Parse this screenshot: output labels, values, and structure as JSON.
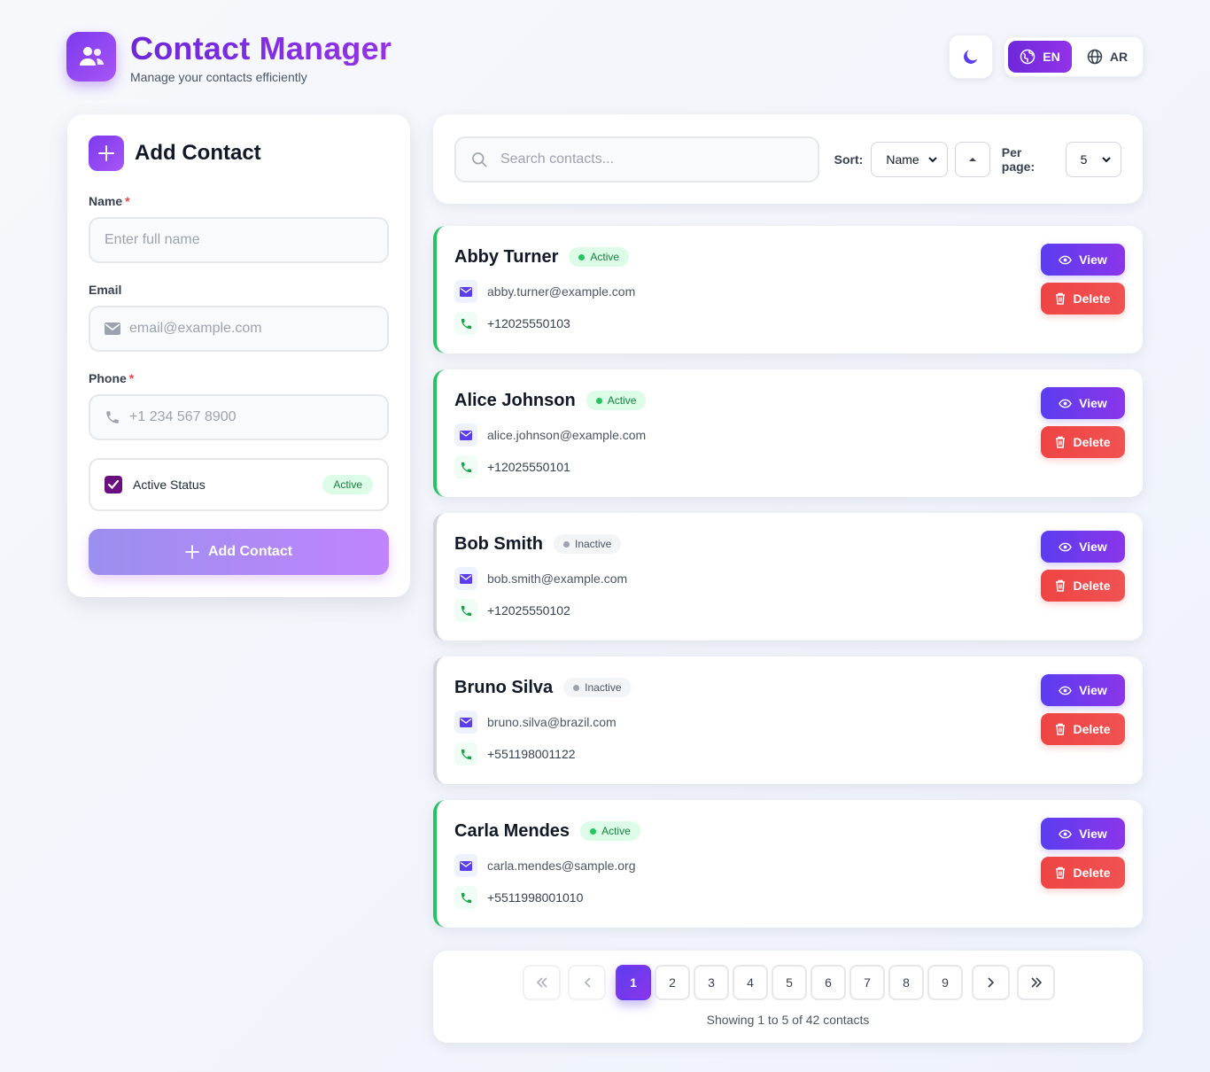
{
  "header": {
    "title": "Contact Manager",
    "subtitle": "Manage your contacts efficiently",
    "languages": [
      {
        "code": "EN",
        "active": true
      },
      {
        "code": "AR",
        "active": false
      }
    ]
  },
  "form": {
    "title": "Add Contact",
    "name_label": "Name",
    "name_placeholder": "Enter full name",
    "email_label": "Email",
    "email_placeholder": "email@example.com",
    "phone_label": "Phone",
    "phone_placeholder": "+1 234 567 8900",
    "required_mark": "*",
    "active_label": "Active Status",
    "active_checked": true,
    "active_pill": "Active",
    "submit_label": "Add Contact"
  },
  "toolbar": {
    "search_placeholder": "Search contacts...",
    "sort_label": "Sort:",
    "sort_value": "Name",
    "per_page_label": "Per page:",
    "per_page_value": "5"
  },
  "contacts": [
    {
      "name": "Abby Turner",
      "status": "Active",
      "email": "abby.turner@example.com",
      "phone": "+12025550103"
    },
    {
      "name": "Alice Johnson",
      "status": "Active",
      "email": "alice.johnson@example.com",
      "phone": "+12025550101"
    },
    {
      "name": "Bob Smith",
      "status": "Inactive",
      "email": "bob.smith@example.com",
      "phone": "+12025550102"
    },
    {
      "name": "Bruno Silva",
      "status": "Inactive",
      "email": "bruno.silva@brazil.com",
      "phone": "+551198001122"
    },
    {
      "name": "Carla Mendes",
      "status": "Active",
      "email": "carla.mendes@sample.org",
      "phone": "+5511998001010"
    }
  ],
  "actions": {
    "view_label": "View",
    "delete_label": "Delete"
  },
  "pagination": {
    "pages": [
      "1",
      "2",
      "3",
      "4",
      "5",
      "6",
      "7",
      "8",
      "9"
    ],
    "current": "1",
    "summary": "Showing 1 to 5 of 42 contacts"
  },
  "colors": {
    "accent": "#6d28d9",
    "active": "#22c55e",
    "danger": "#ef4444"
  }
}
